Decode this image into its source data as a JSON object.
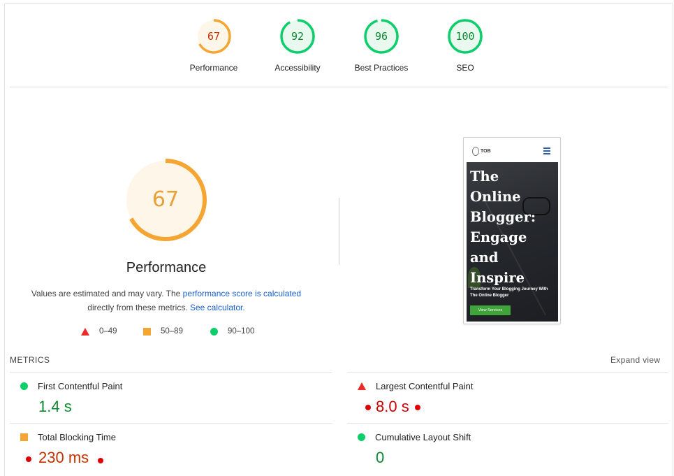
{
  "scores": [
    {
      "value": "67",
      "label": "Performance",
      "fraction": 0.67,
      "color": "#f5a532",
      "fill": "#fff6ea",
      "text_color": "#c33300"
    },
    {
      "value": "92",
      "label": "Accessibility",
      "fraction": 0.92,
      "color": "#0cce6b",
      "fill": "#e9f9ef",
      "text_color": "#0a8a2e"
    },
    {
      "value": "96",
      "label": "Best Practices",
      "fraction": 0.96,
      "color": "#0cce6b",
      "fill": "#e9f9ef",
      "text_color": "#0a8a2e"
    },
    {
      "value": "100",
      "label": "SEO",
      "fraction": 1.0,
      "color": "#0cce6b",
      "fill": "#e9f9ef",
      "text_color": "#0a8a2e"
    }
  ],
  "performance": {
    "score": "67",
    "score_fraction": 0.67,
    "title": "Performance",
    "desc_part1": "Values are estimated and may vary. The ",
    "desc_link1": "performance score is calculated",
    "desc_part2": "directly from these metrics. ",
    "desc_link2": "See calculator."
  },
  "legend": [
    {
      "range": "0–49",
      "shape": "triangle",
      "color": "#eb2a2a"
    },
    {
      "range": "50–89",
      "shape": "square",
      "color": "#f5a532"
    },
    {
      "range": "90–100",
      "shape": "circle",
      "color": "#0cce6b"
    }
  ],
  "screenshot": {
    "logo_text": "TOB",
    "hero_title": "The\nOnline\nBlogger:\nEngage\nand\nInspire",
    "hero_subtitle": "Transform Your Blogging Journey With\nThe Online Blogger",
    "hero_button": "View Services"
  },
  "metrics": {
    "label": "METRICS",
    "expand": "Expand view",
    "fcp": {
      "name": "First Contentful Paint",
      "value": "1.4 s",
      "status": "good"
    },
    "lcp": {
      "name": "Largest Contentful Paint",
      "value": "8.0 s",
      "status": "bad"
    },
    "tbt": {
      "name": "Total Blocking Time",
      "value": "230 ms",
      "status": "average"
    },
    "cls": {
      "name": "Cumulative Layout Shift",
      "value": "0",
      "status": "good"
    }
  }
}
